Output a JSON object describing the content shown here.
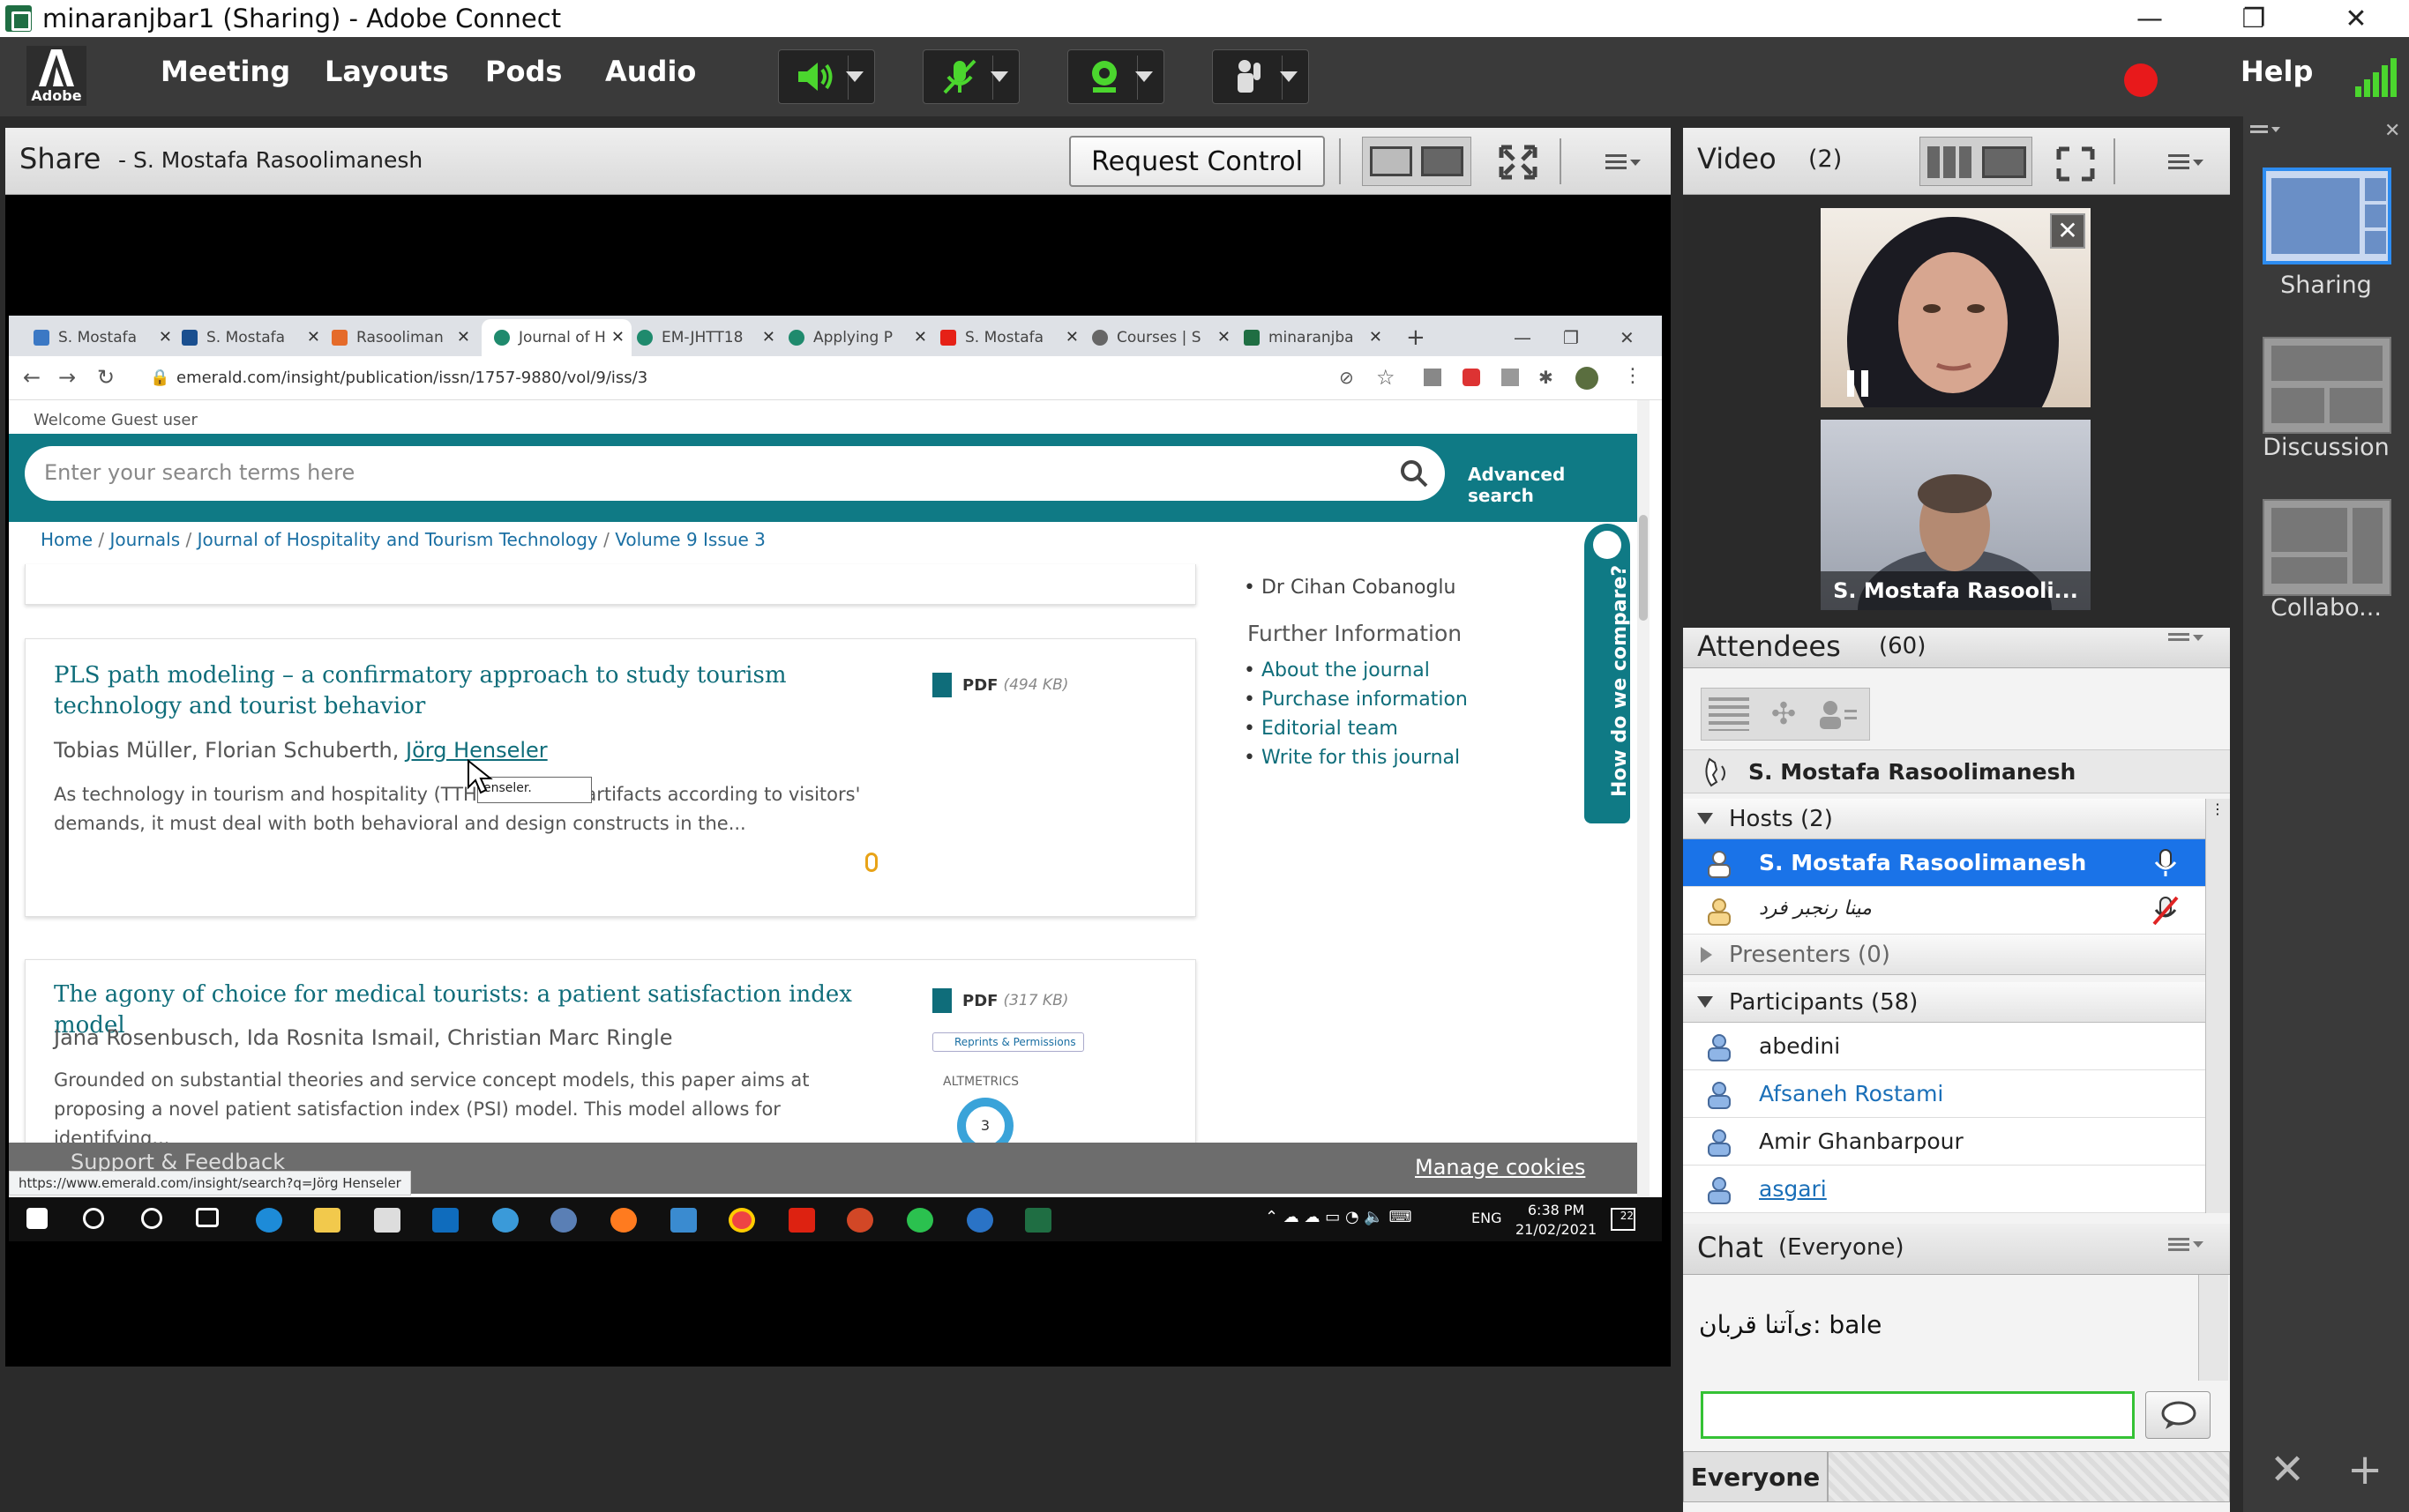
{
  "window": {
    "title": "minaranjbar1 (Sharing) - Adobe Connect"
  },
  "menubar": {
    "adobe_label": "Adobe",
    "items": [
      "Meeting",
      "Layouts",
      "Pods",
      "Audio"
    ],
    "help": "Help",
    "colors": {
      "speaker": "#4bd62e",
      "camera": "#4bd62e",
      "record": "#e8191b"
    }
  },
  "share": {
    "title": "Share",
    "presenter": "- S. Mostafa Rasoolimanesh",
    "request_control": "Request Control"
  },
  "browser": {
    "tabs": [
      "S. Mostafa",
      "S. Mostafa",
      "Rasooliman",
      "Journal of H",
      "EM-JHTT18",
      "Applying P",
      "S. Mostafa",
      "Courses | S",
      "minaranjba"
    ],
    "url": "emerald.com/insight/publication/issn/1757-9880/vol/9/iss/3",
    "welcome": "Welcome Guest user",
    "search_placeholder": "Enter your search terms here",
    "advanced_search": "Advanced search",
    "breadcrumbs": [
      "Home",
      "Journals",
      "Journal of Hospitality and Tourism Technology",
      "Volume 9 Issue 3"
    ],
    "editor": "Dr Cihan Cobanoglu",
    "further_info_title": "Further Information",
    "further_info": [
      "About the journal",
      "Purchase information",
      "Editorial team",
      "Write for this journal"
    ],
    "compare_tab": "How do we compare?",
    "articles": [
      {
        "title": "PLS path modeling – a confirmatory approach to study tourism technology and tourist behavior",
        "authors": "Tobias Müller, Florian Schuberth, ",
        "author_link": "Jörg Henseler",
        "desc": "As technology in tourism and hospitality (TTH) ... chnical artifacts according to visitors' demands, it must deal with both behavioral and design constructs in the...",
        "pdf": "PDF",
        "size": "(494 KB)"
      },
      {
        "title": "The agony of choice for medical tourists: a patient satisfaction index model",
        "authors": "Jana Rosenbusch, Ida Rosnita Ismail, Christian Marc Ringle",
        "desc": "Grounded on substantial theories and service concept models, this paper aims at proposing a novel patient satisfaction index (PSI) model. This model allows for identifying...",
        "pdf": "PDF",
        "size": "(317 KB)",
        "reprints": "Reprints & Permissions",
        "altmetrics": "ALTMETRICS",
        "altmetric_score": "3"
      }
    ],
    "tooltip": "enseler.",
    "support": "Support & Feedback",
    "manage_cookies": "Manage cookies",
    "status_url": "https://www.emerald.com/insight/search?q=Jörg Henseler"
  },
  "taskbar": {
    "lang": "ENG",
    "time": "6:38 PM",
    "date": "21/02/2021",
    "notif_count": "22"
  },
  "video": {
    "title": "Video",
    "count": "(2)",
    "cam2_label": "S. Mostafa Rasooli..."
  },
  "attendees": {
    "title": "Attendees",
    "count": "(60)",
    "active_speaker": "S. Mostafa Rasoolimanesh",
    "groups": {
      "hosts": "Hosts (2)",
      "presenters": "Presenters (0)",
      "participants": "Participants (58)"
    },
    "hosts": [
      "S. Mostafa Rasoolimanesh",
      "مینا رنجبر فرد"
    ],
    "participants": [
      "abedini",
      "Afsaneh Rostami",
      "Amir Ghanbarpour",
      "asgari"
    ]
  },
  "chat": {
    "title": "Chat",
    "scope": "(Everyone)",
    "message": "ی‌آتنا قربان: bale",
    "input_value": "",
    "recipient": "Everyone"
  },
  "layouts": {
    "items": [
      "Sharing",
      "Discussion",
      "Collabo..."
    ]
  }
}
